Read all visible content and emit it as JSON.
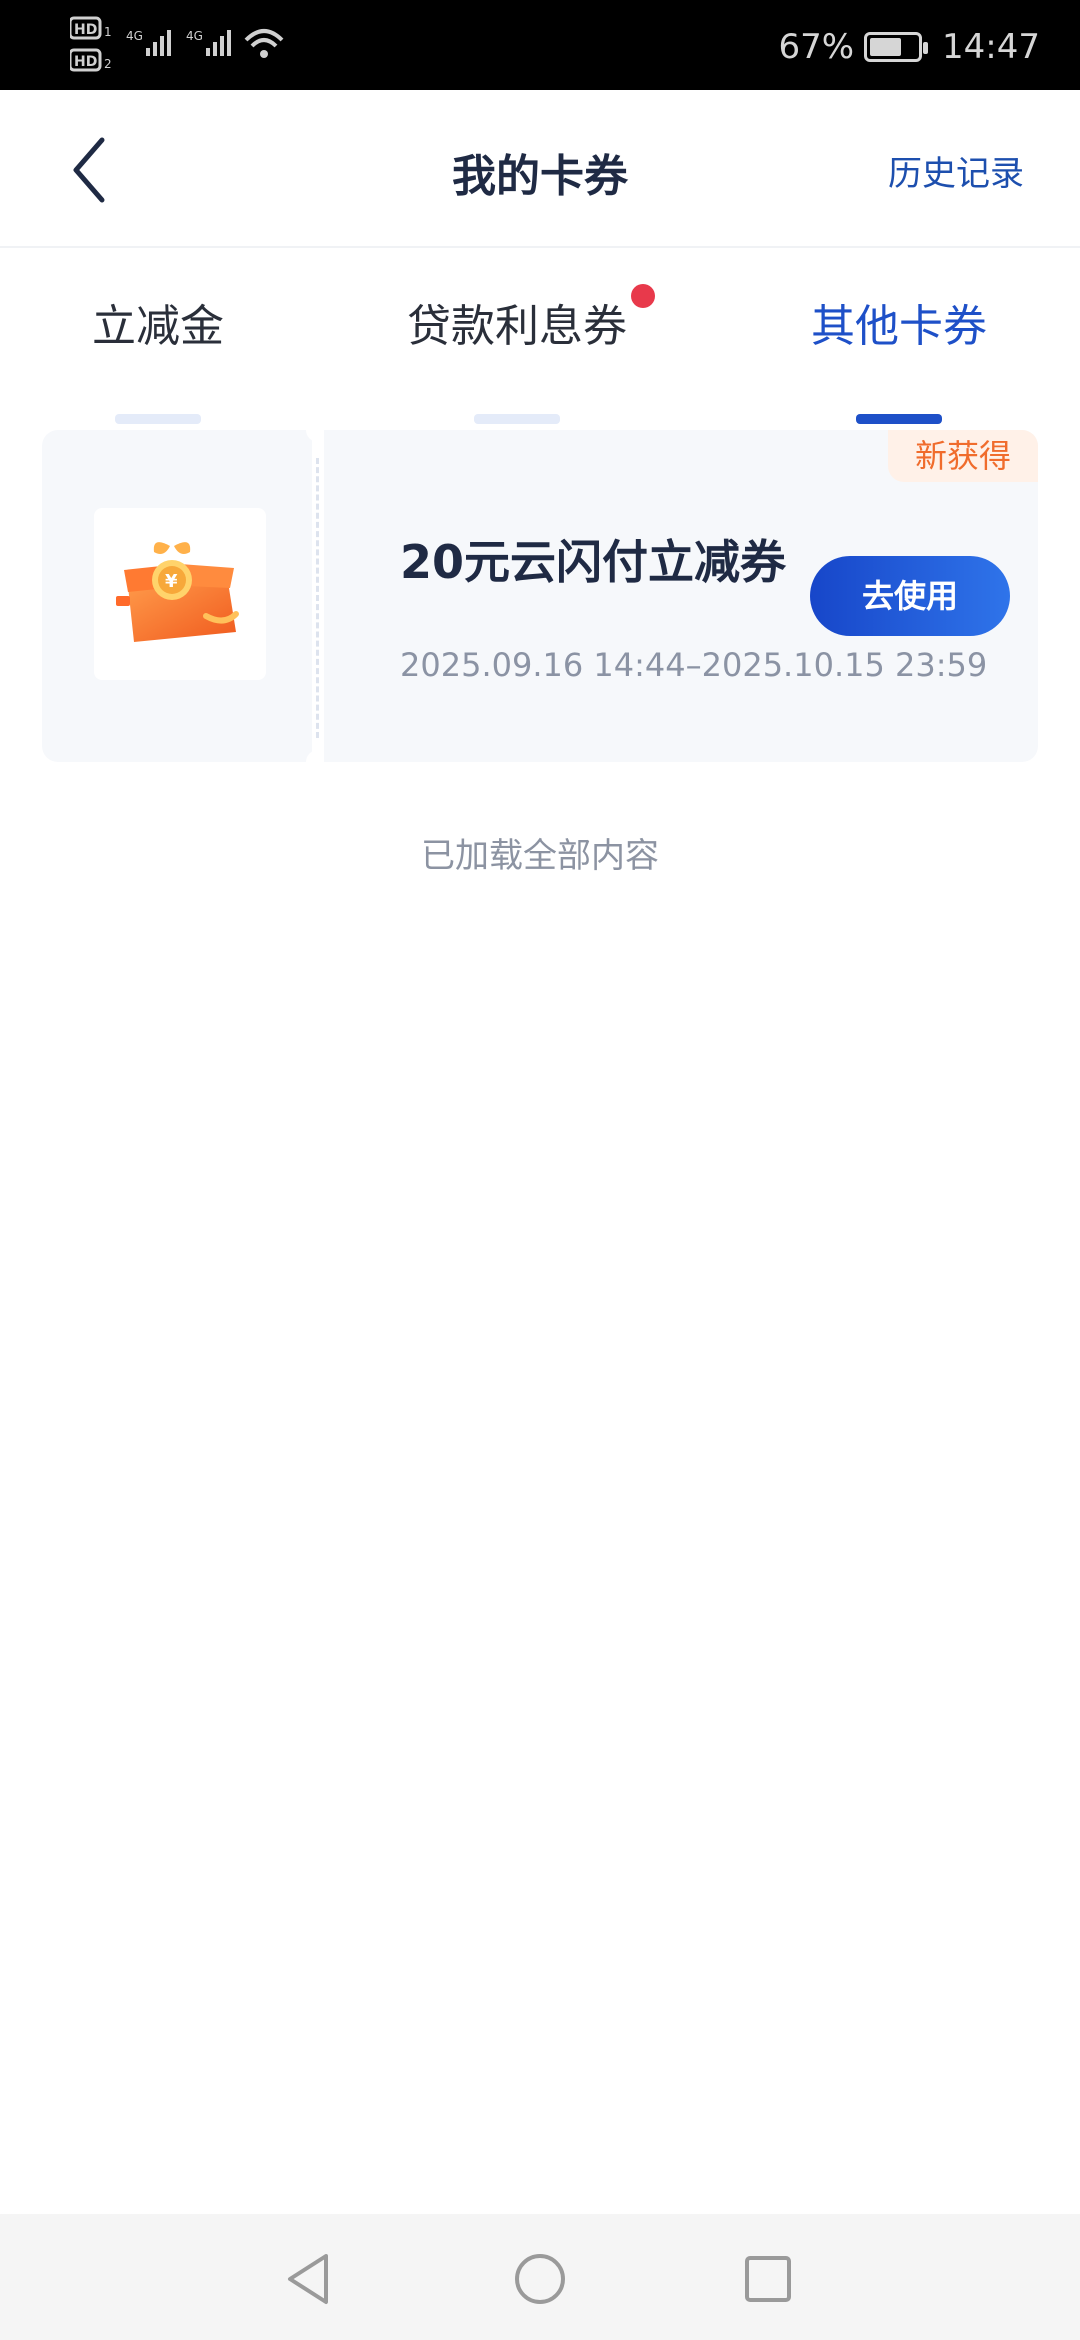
{
  "status_bar": {
    "left_icons": [
      "hd-1-icon",
      "hd-2-icon",
      "signal-4g-icon",
      "signal-4g-icon",
      "wifi-icon"
    ],
    "battery_percent_text": "67%",
    "battery_level": 0.67,
    "time": "14:47"
  },
  "header": {
    "back_icon": "chevron-left-icon",
    "title": "我的卡券",
    "history_label": "历史记录"
  },
  "tabs": [
    {
      "label": "立减金",
      "active": false,
      "has_dot": false
    },
    {
      "label": "贷款利息券",
      "active": false,
      "has_dot": true
    },
    {
      "label": "其他卡券",
      "active": true,
      "has_dot": false
    }
  ],
  "coupon": {
    "badge": "新获得",
    "title": "20元云闪付立减券",
    "validity": "2025.09.16 14:44–2025.10.15 23:59",
    "button_label": "去使用",
    "thumbnail_icon": "gift-box-icon"
  },
  "footer_text": "已加载全部内容",
  "nav_bar": {
    "icons": [
      "back-triangle-icon",
      "home-circle-icon",
      "recents-square-icon"
    ]
  },
  "colors": {
    "accent": "#1e50c8",
    "title_text": "#1f2a44",
    "badge_text": "#f06c2c",
    "red_dot": "#e8394b"
  }
}
